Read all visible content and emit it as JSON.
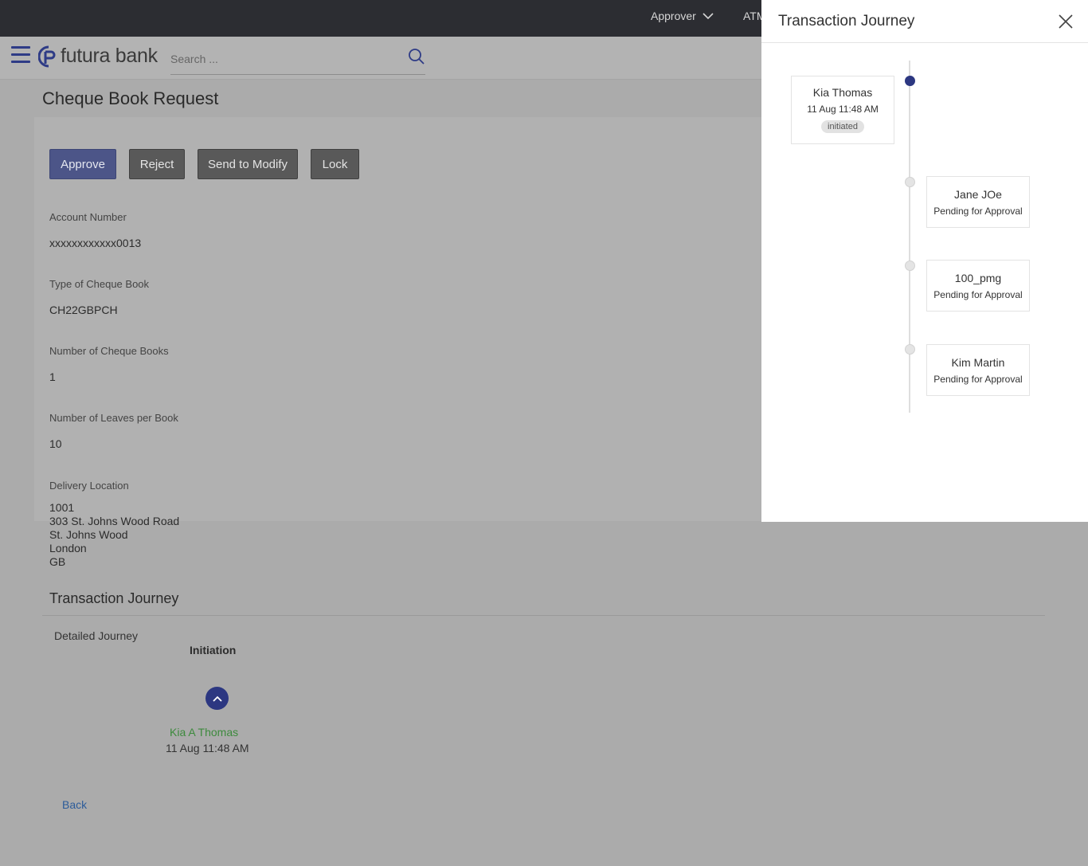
{
  "topbar": {
    "role_label": "Approver",
    "next_label": "ATM"
  },
  "header": {
    "logo_text": "futura bank",
    "search_placeholder": "Search ..."
  },
  "page": {
    "title": "Cheque Book Request"
  },
  "actions": {
    "approve": "Approve",
    "reject": "Reject",
    "send_to_modify": "Send to Modify",
    "lock": "Lock"
  },
  "fields": [
    {
      "label": "Account Number",
      "value": "xxxxxxxxxxxx0013"
    },
    {
      "label": "Type of Cheque Book",
      "value": "CH22GBPCH"
    },
    {
      "label": "Number of Cheque Books",
      "value": "1"
    },
    {
      "label": "Number of Leaves per Book",
      "value": "10"
    },
    {
      "label": "Delivery Location",
      "value_lines": [
        "1001",
        "303 St. Johns Wood Road",
        "St. Johns Wood",
        "London",
        "GB"
      ]
    }
  ],
  "journey": {
    "title": "Transaction Journey",
    "detailed_label": "Detailed Journey",
    "stage": "Initiation",
    "initiator_name": "Kia A Thomas",
    "initiator_time": "11 Aug 11:48 AM"
  },
  "back_label": "Back",
  "panel": {
    "title": "Transaction Journey",
    "steps": [
      {
        "name": "Kia Thomas",
        "time": "11 Aug 11:48 AM",
        "badge": "initiated"
      },
      {
        "name": "Jane JOe",
        "status": "Pending for Approval"
      },
      {
        "name": "100_pmg",
        "status": "Pending for Approval"
      },
      {
        "name": "Kim Martin",
        "status": "Pending for Approval"
      }
    ]
  },
  "colors": {
    "accent": "#2c3781",
    "approve_button": "#4c5588",
    "initiator_name": "#3d8a3d",
    "topbar": "#2c2d32"
  }
}
